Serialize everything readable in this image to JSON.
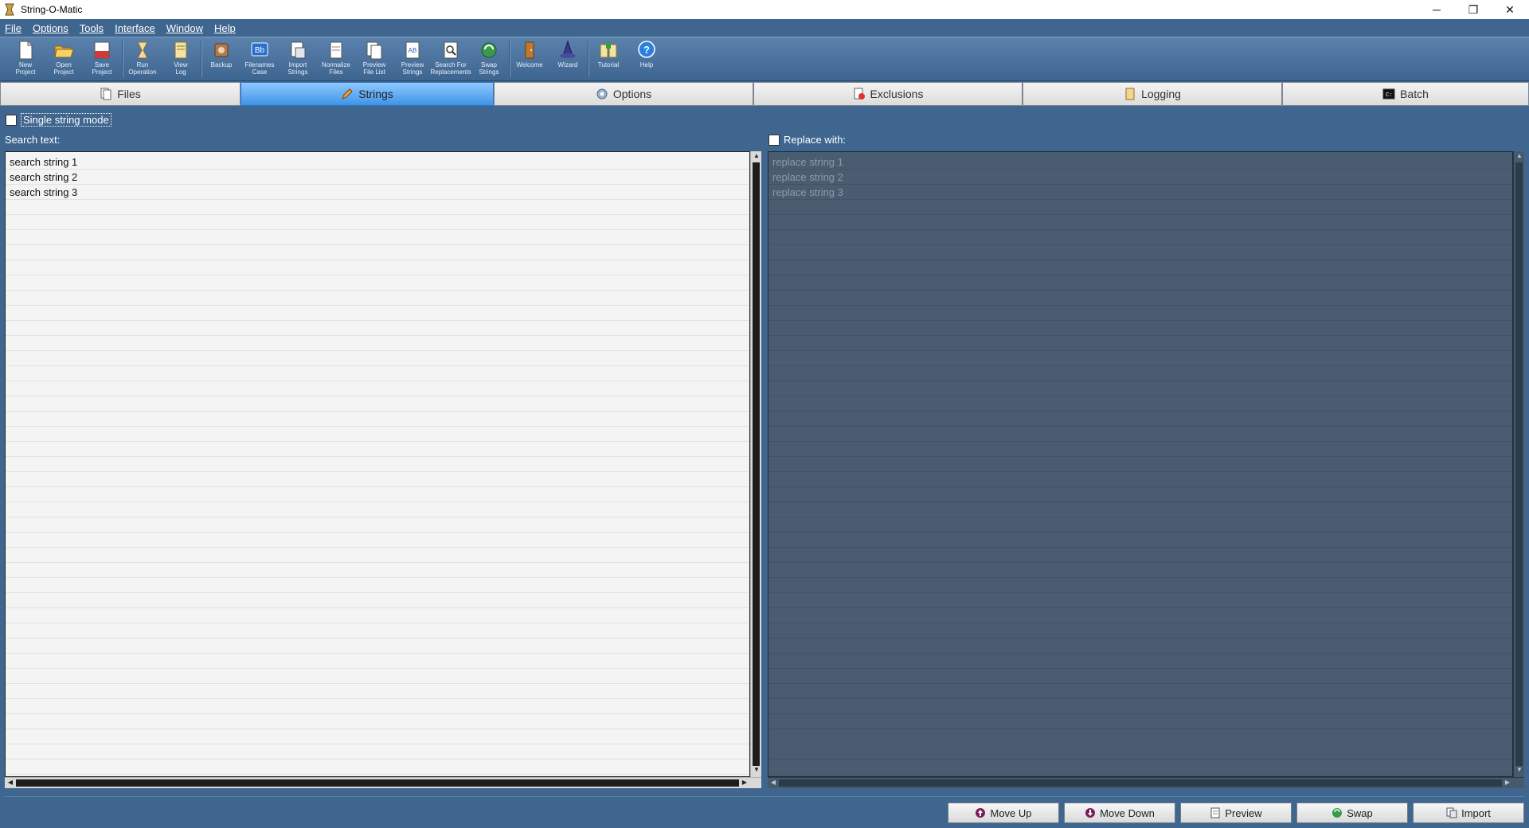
{
  "window": {
    "title": "String-O-Matic",
    "controls": {
      "minimize": "─",
      "restore": "❐",
      "close": "✕"
    }
  },
  "menu": [
    "File",
    "Options",
    "Tools",
    "Interface",
    "Window",
    "Help"
  ],
  "toolbar": [
    {
      "label": "New\nProject",
      "icon": "new-project-icon"
    },
    {
      "label": "Open\nProject",
      "icon": "open-project-icon"
    },
    {
      "label": "Save\nProject",
      "icon": "save-project-icon"
    },
    {
      "label": "Run\nOperation",
      "icon": "run-operation-icon"
    },
    {
      "label": "View\nLog",
      "icon": "view-log-icon"
    },
    {
      "label": "Backup",
      "icon": "backup-icon"
    },
    {
      "label": "Filenames\nCase",
      "icon": "filenames-case-icon"
    },
    {
      "label": "Import\nStrings",
      "icon": "import-strings-icon"
    },
    {
      "label": "Normalize\nFiles",
      "icon": "normalize-files-icon"
    },
    {
      "label": "Preview\nFile List",
      "icon": "preview-file-list-icon"
    },
    {
      "label": "Preview\nStrings",
      "icon": "preview-strings-icon"
    },
    {
      "label": "Search For\nReplacements",
      "icon": "search-replacements-icon"
    },
    {
      "label": "Swap\nStrings",
      "icon": "swap-strings-icon"
    },
    {
      "label": "Welcome",
      "icon": "welcome-icon"
    },
    {
      "label": "Wizard",
      "icon": "wizard-icon"
    },
    {
      "label": "Tutorial",
      "icon": "tutorial-icon"
    },
    {
      "label": "Help",
      "icon": "help-icon"
    }
  ],
  "tabs": [
    {
      "label": "Files",
      "icon": "files-icon"
    },
    {
      "label": "Strings",
      "icon": "pencil-icon",
      "active": true
    },
    {
      "label": "Options",
      "icon": "gear-icon"
    },
    {
      "label": "Exclusions",
      "icon": "exclusions-icon"
    },
    {
      "label": "Logging",
      "icon": "logging-icon"
    },
    {
      "label": "Batch",
      "icon": "batch-icon"
    }
  ],
  "strings": {
    "single_mode_label": "Single string mode",
    "search_label": "Search text:",
    "replace_label": "Replace with:",
    "search_items": [
      "search string 1",
      "search string 2",
      "search string 3"
    ],
    "replace_items": [
      "replace string 1",
      "replace string 2",
      "replace string 3"
    ]
  },
  "buttons": [
    {
      "label": "Move Up",
      "icon": "arrow-up-icon"
    },
    {
      "label": "Move Down",
      "icon": "arrow-down-icon"
    },
    {
      "label": "Preview",
      "icon": "preview-icon"
    },
    {
      "label": "Swap",
      "icon": "swap-icon"
    },
    {
      "label": "Import",
      "icon": "import-icon"
    }
  ],
  "colors": {
    "background": "#3f668f",
    "active_tab": "#3f93e6",
    "replace_panel": "#4a5c70"
  }
}
